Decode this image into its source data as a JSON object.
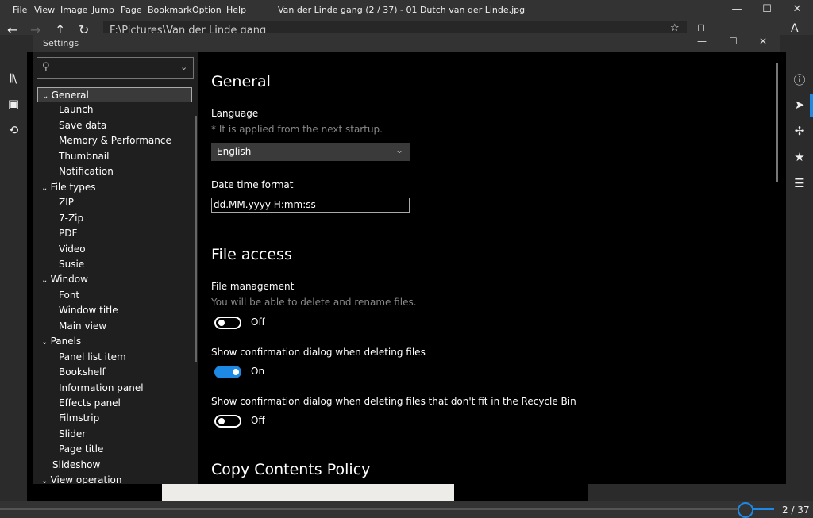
{
  "menu": [
    "File",
    "View",
    "Image",
    "Jump",
    "Page",
    "Bookmark",
    "Option",
    "Help"
  ],
  "window_title": "Van der Linde gang (2 / 37) - 01 Dutch van der Linde.jpg",
  "address": "F:\\Pictures\\Van der Linde gang",
  "settings": {
    "title": "Settings",
    "search_placeholder": "",
    "tree": [
      {
        "label": "General",
        "level": 0,
        "expanded": true,
        "selected": true
      },
      {
        "label": "Launch",
        "level": 1
      },
      {
        "label": "Save data",
        "level": 1
      },
      {
        "label": "Memory & Performance",
        "level": 1
      },
      {
        "label": "Thumbnail",
        "level": 1
      },
      {
        "label": "Notification",
        "level": 1
      },
      {
        "label": "File types",
        "level": 0,
        "expanded": true
      },
      {
        "label": "ZIP",
        "level": 1
      },
      {
        "label": "7-Zip",
        "level": 1
      },
      {
        "label": "PDF",
        "level": 1
      },
      {
        "label": "Video",
        "level": 1
      },
      {
        "label": "Susie",
        "level": 1
      },
      {
        "label": "Window",
        "level": 0,
        "expanded": true
      },
      {
        "label": "Font",
        "level": 1
      },
      {
        "label": "Window title",
        "level": 1
      },
      {
        "label": "Main view",
        "level": 1
      },
      {
        "label": "Panels",
        "level": 0,
        "expanded": true
      },
      {
        "label": "Panel list item",
        "level": 1
      },
      {
        "label": "Bookshelf",
        "level": 1
      },
      {
        "label": "Information panel",
        "level": 1
      },
      {
        "label": "Effects panel",
        "level": 1
      },
      {
        "label": "Filmstrip",
        "level": 1
      },
      {
        "label": "Slider",
        "level": 1
      },
      {
        "label": "Page title",
        "level": 1
      },
      {
        "label": "Slideshow",
        "level": 0
      },
      {
        "label": "View operation",
        "level": 0,
        "expanded": true
      }
    ],
    "content": {
      "general_title": "General",
      "language_label": "Language",
      "language_note": "* It is applied from the next startup.",
      "language_value": "English",
      "datetime_label": "Date time format",
      "datetime_value": "dd.MM.yyyy H:mm:ss",
      "file_access_title": "File access",
      "file_mgmt_label": "File management",
      "file_mgmt_note": "You will be able to delete and rename files.",
      "file_mgmt_state": "Off",
      "confirm_delete_label": "Show confirmation dialog when deleting files",
      "confirm_delete_state": "On",
      "confirm_recycle_label": "Show confirmation dialog when deleting files that don't fit in the Recycle Bin",
      "confirm_recycle_state": "Off",
      "copy_policy_title": "Copy Contents Policy"
    }
  },
  "page_indicator": "2 / 37",
  "page_current": 2,
  "page_total": 37,
  "accent_color": "#1e88e5"
}
